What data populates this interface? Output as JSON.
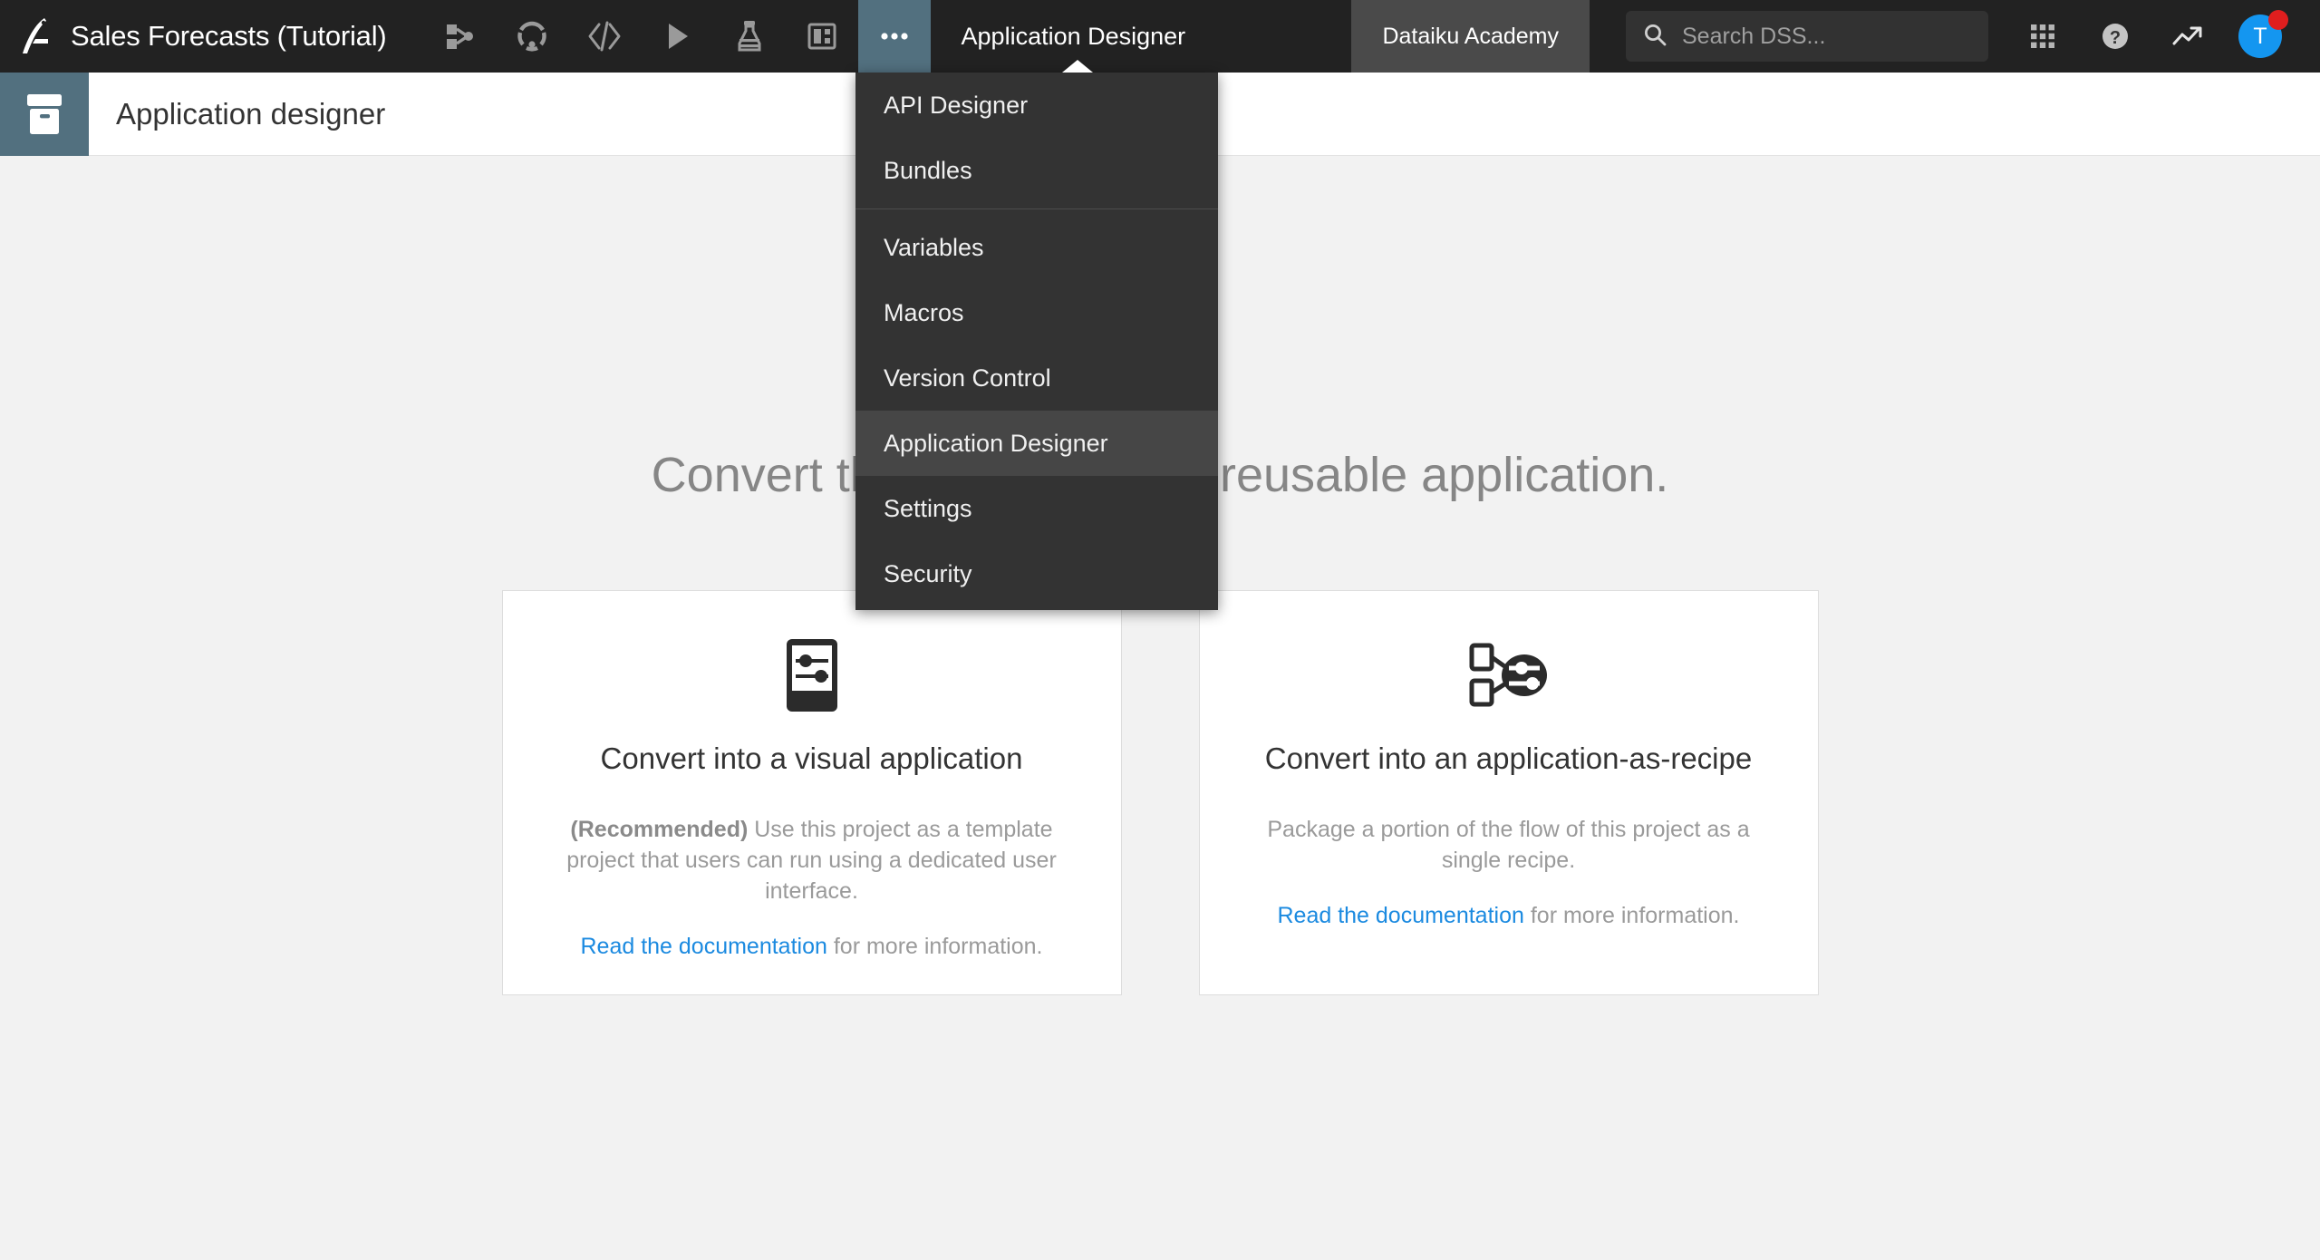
{
  "topbar": {
    "logo_icon": "dataiku-bird-logo",
    "project_title": "Sales Forecasts (Tutorial)",
    "nav_icons": [
      {
        "name": "flow-icon",
        "label": "Flow"
      },
      {
        "name": "lab-icon",
        "label": "Lab"
      },
      {
        "name": "code-icon",
        "label": "Code"
      },
      {
        "name": "run-icon",
        "label": "Jobs"
      },
      {
        "name": "automation-icon",
        "label": "Automation"
      },
      {
        "name": "dashboard-icon",
        "label": "Dashboards"
      },
      {
        "name": "more-icon",
        "label": "More"
      }
    ],
    "current_section": "Application Designer",
    "academy_label": "Dataiku Academy",
    "search_placeholder": "Search DSS...",
    "search_value": "",
    "search_icon": "search-icon",
    "apps_icon": "apps-grid-icon",
    "help_icon": "help-circle-icon",
    "trending_icon": "trending-up-icon",
    "avatar_initial": "T",
    "has_notification": true
  },
  "dropdown": {
    "items": [
      {
        "label": "API Designer",
        "highlighted": false,
        "divider_after": false
      },
      {
        "label": "Bundles",
        "highlighted": false,
        "divider_after": true
      },
      {
        "label": "Variables",
        "highlighted": false,
        "divider_after": false
      },
      {
        "label": "Macros",
        "highlighted": false,
        "divider_after": false
      },
      {
        "label": "Version Control",
        "highlighted": false,
        "divider_after": false
      },
      {
        "label": "Application Designer",
        "highlighted": true,
        "divider_after": false
      },
      {
        "label": "Settings",
        "highlighted": false,
        "divider_after": false
      },
      {
        "label": "Security",
        "highlighted": false,
        "divider_after": false
      }
    ]
  },
  "subheader": {
    "icon": "app-box-icon",
    "title": "Application designer"
  },
  "main": {
    "headline": "Convert this project into a reusable application.",
    "cards": [
      {
        "icon": "visual-application-icon",
        "title": "Convert into a visual application",
        "desc_bold": "(Recommended)",
        "desc_rest": " Use this project as a template project that users can run using a dedicated user interface.",
        "link_text": "Read the documentation",
        "link_suffix": " for more information."
      },
      {
        "icon": "application-as-recipe-icon",
        "title": "Convert into an application-as-recipe",
        "desc_bold": "",
        "desc_rest": "Package a portion of the flow of this project as a single recipe.",
        "link_text": "Read the documentation",
        "link_suffix": " for more information."
      }
    ]
  },
  "colors": {
    "topbar_bg": "#222222",
    "menu_bg": "#333333",
    "menu_highlight": "#464646",
    "accent_teal": "#52707f",
    "link_blue": "#1b8ae0",
    "avatar_blue": "#1496f0",
    "notification_red": "#e01e1e",
    "page_bg": "#f2f2f2"
  }
}
